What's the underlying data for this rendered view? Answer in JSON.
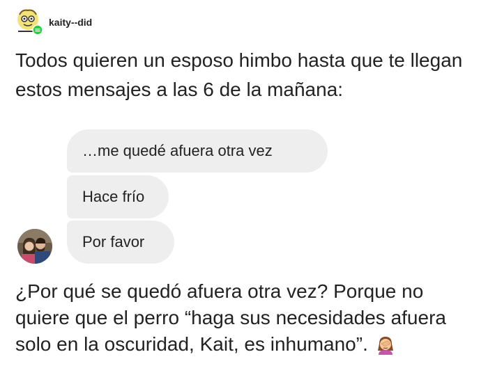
{
  "post": {
    "username": "kaity--did",
    "intro_text": "Todos quieren un esposo himbo hasta que te llegan estos mensajes a las 6 de la mañana:",
    "outro_text": "¿Por qué se quedó afuera otra vez? Porque no quiere que el perro “haga sus necesidades afuera solo en la oscuridad, Kait, es inhumano”."
  },
  "chat": {
    "messages": [
      {
        "text": "…me quedé afuera otra vez"
      },
      {
        "text": "Hace frío"
      },
      {
        "text": "Por favor"
      }
    ]
  },
  "icons": {
    "user_avatar": "doodle-face-avatar-icon",
    "badge": "green-badge-icon",
    "contact_avatar": "couple-photo-avatar",
    "emoji": "face-palm-emoji"
  },
  "colors": {
    "bubble": "#eeeeee",
    "text": "#222222",
    "badge": "#2ecc40"
  }
}
